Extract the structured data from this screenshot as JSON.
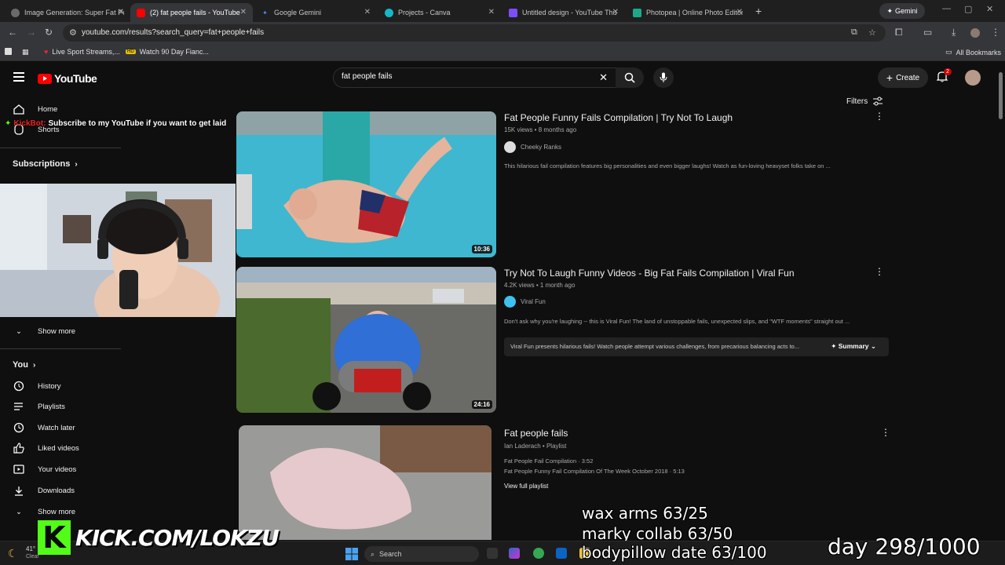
{
  "browser": {
    "tabs": [
      {
        "label": "Image Generation: Super Fat Pe",
        "fav_color": "#6b6b6b",
        "active": false
      },
      {
        "label": "(2) fat people fails - YouTube",
        "fav_color": "#ff0000",
        "active": true
      },
      {
        "label": "Google Gemini",
        "fav_color": "#4a8cff",
        "active": false
      },
      {
        "label": "Projects - Canva",
        "fav_color": "#17b6c9",
        "active": false
      },
      {
        "label": "Untitled design - YouTube Thu",
        "fav_color": "#7c4dff",
        "active": false
      },
      {
        "label": "Photopea | Online Photo Editor",
        "fav_color": "#1ea88a",
        "active": false
      }
    ],
    "gemini_button": "Gemini",
    "url": "youtube.com/results?search_query=fat+people+fails",
    "bookmarks": [
      {
        "label": "Live Sport Streams,..."
      },
      {
        "label": "Watch 90 Day Fianc..."
      }
    ],
    "all_bookmarks": "All Bookmarks"
  },
  "youtube": {
    "logo_text": "YouTube",
    "search_value": "fat people fails",
    "create_label": "Create",
    "notification_count": "2",
    "filters_label": "Filters"
  },
  "sidebar": {
    "home": "Home",
    "shorts": "Shorts",
    "subscriptions": "Subscriptions",
    "show_more_1": "Show more",
    "you": "You",
    "items": [
      {
        "label": "History",
        "icon": "history-icon"
      },
      {
        "label": "Playlists",
        "icon": "playlists-icon"
      },
      {
        "label": "Watch later",
        "icon": "watch-later-icon"
      },
      {
        "label": "Liked videos",
        "icon": "liked-icon"
      },
      {
        "label": "Your videos",
        "icon": "your-videos-icon"
      },
      {
        "label": "Downloads",
        "icon": "downloads-icon"
      }
    ],
    "show_more_2": "Show more"
  },
  "results": [
    {
      "title": "Fat People Funny Fails Compilation | Try Not To Laugh",
      "meta": "15K views • 8 months ago",
      "channel": "Cheeky Ranks",
      "description": "This hilarious fail compilation features big personalities and even bigger laughs! Watch as fun-loving heavyset folks take on ...",
      "duration": "10:36"
    },
    {
      "title": "Try Not To Laugh Funny Videos - Big Fat Fails Compilation | Viral Fun",
      "meta": "4.2K views • 1 month ago",
      "channel": "Viral Fun",
      "description": "Don't ask why you're laughing -- this is Viral Fun! The land of unstoppable fails, unexpected slips, and \"WTF moments\" straight out ...",
      "summary_text": "Viral Fun presents hilarious fails! Watch people attempt various challenges, from precarious balancing acts to...",
      "summary_button": "Summary",
      "duration": "24:16"
    },
    {
      "title": "Fat people fails",
      "meta": "Ian Laderach • Playlist",
      "items": [
        "Fat People Fail Compilation · 3:52",
        "Fat People Funny Fail Compilation Of The Week October 2018 · 5:13"
      ],
      "view_full": "View full playlist"
    }
  ],
  "stream_overlay": {
    "kick_alert_name": "KickBot:",
    "kick_alert_text": "Subscribe to my YouTube if you want to get laid",
    "goal_1": "wax arms 63/25",
    "goal_2": "marky collab 63/50",
    "goal_3": "bodypillow date 63/100",
    "day_counter": "day 298/1000",
    "kick_url": "KICK.COM/LOKZU",
    "kick_letter": "K",
    "brand_color": "#53fc18"
  },
  "taskbar": {
    "search_label": "Search",
    "weather_temp": "41°",
    "weather_text": "Clear"
  }
}
